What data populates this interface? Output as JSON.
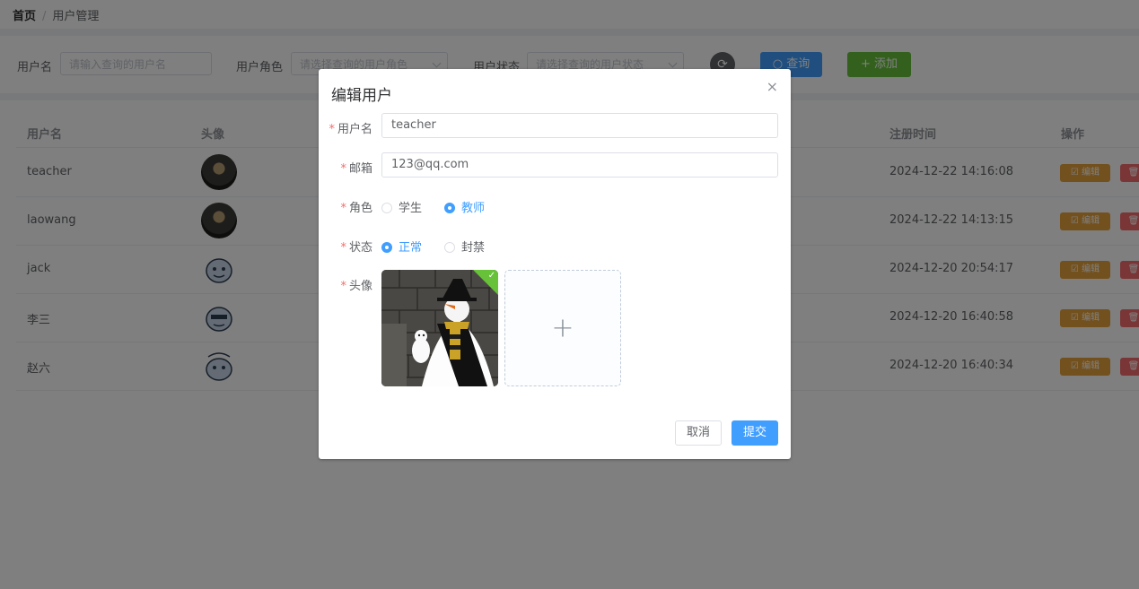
{
  "breadcrumb": {
    "home": "首页",
    "separator": "/",
    "current": "用户管理"
  },
  "filter": {
    "username_label": "用户名",
    "username_placeholder": "请输入查询的用户名",
    "role_label": "用户角色",
    "role_placeholder": "请选择查询的用户角色",
    "status_label": "用户状态",
    "status_placeholder": "请选择查询的用户状态",
    "search_label": "○ 查询",
    "add_label": "+ 添加"
  },
  "table": {
    "headers": {
      "username": "用户名",
      "avatar": "头像",
      "register_time": "注册时间",
      "actions": "操作"
    },
    "rows": [
      {
        "username": "teacher",
        "register_time": "2024-12-22 14:16:08",
        "avatar": "dark-photo"
      },
      {
        "username": "laowang",
        "register_time": "2024-12-22 14:13:15",
        "avatar": "dark-photo"
      },
      {
        "username": "jack",
        "register_time": "2024-12-20 20:54:17",
        "avatar": "cartoon"
      },
      {
        "username": "李三",
        "register_time": "2024-12-20 16:40:58",
        "avatar": "cartoon"
      },
      {
        "username": "赵六",
        "register_time": "2024-12-20 16:40:34",
        "avatar": "cartoon"
      }
    ],
    "edit_label": "编辑",
    "delete_label": "删"
  },
  "dialog": {
    "title": "编辑用户",
    "close": "×",
    "username_label": "用户名",
    "username_value": "teacher",
    "email_label": "邮箱",
    "email_value": "123@qq.com",
    "role_label": "角色",
    "role_options": [
      "学生",
      "教师"
    ],
    "role_selected": "教师",
    "status_label": "状态",
    "status_options": [
      "正常",
      "封禁"
    ],
    "status_selected": "正常",
    "avatar_label": "头像",
    "cancel_label": "取消",
    "submit_label": "提交"
  },
  "colors": {
    "primary": "#409eff",
    "success": "#67c23a",
    "warning": "#e6a23c",
    "danger": "#f56c6c"
  }
}
